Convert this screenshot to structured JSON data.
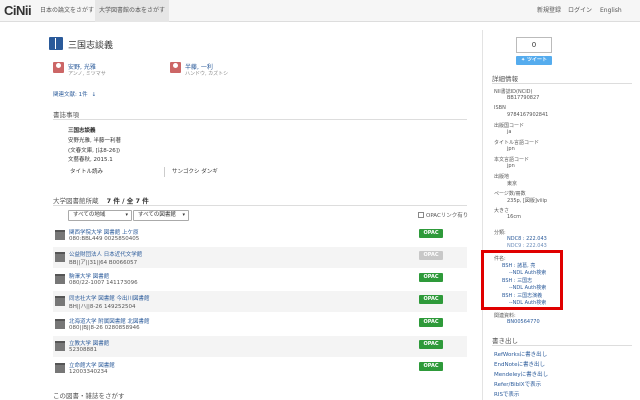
{
  "topbar": {
    "logo": "CiNii",
    "tabs": [
      "日本の論文をさがす",
      "大学図書館の本をさがす"
    ],
    "links": [
      "新規登録",
      "ログイン",
      "English"
    ]
  },
  "book": {
    "title": "三国志談義",
    "authors": [
      {
        "name": "安野, 光雅",
        "kana": "アンノ, ミツマサ"
      },
      {
        "name": "半藤, 一利",
        "kana": "ハンドウ, カズトシ"
      }
    ],
    "related": "関連文献: 1件"
  },
  "bibliography": {
    "heading": "書誌事項",
    "lines": [
      "三国志談義",
      "安野光雅, 半藤一利著",
      "(文春文庫, [は8-26])",
      "文藝春秋, 2015.1"
    ],
    "tags": [
      "タイトル読み",
      "サンゴクシ ダンギ"
    ]
  },
  "holdings": {
    "heading_prefix": "大学図書館所蔵",
    "count_text": "7 件 / 全 7 件",
    "filter_region": "すべての地域",
    "filter_library": "すべての図書館",
    "opac_toggle": "OPACリンク有り",
    "rows": [
      {
        "library": "関西学院大学 図書館 上ケ原",
        "call": "080:BBL449 0025850405",
        "opac": "OPAC",
        "opac_active": true
      },
      {
        "library": "公益財団法人 日本近代文学館",
        "call": "BB||ア||31||64 B0066057",
        "opac": "OPAC",
        "opac_active": false
      },
      {
        "library": "駒澤大学 図書館",
        "call": "080/22-1007 141173096",
        "opac": "OPAC",
        "opac_active": true
      },
      {
        "library": "同志社大学 図書館 今出川図書館",
        "call": "BH||ハ||8-26 149252504",
        "opac": "OPAC",
        "opac_active": true
      },
      {
        "library": "北海道大学 附属図書館 北図書館",
        "call": "080||BJ|8-26 0280858946",
        "opac": "OPAC",
        "opac_active": true
      },
      {
        "library": "立教大学 図書館",
        "call": "52308881",
        "opac": "OPAC",
        "opac_active": true
      },
      {
        "library": "立命館大学 図書館",
        "call": "12003340234",
        "opac": "OPAC",
        "opac_active": true
      }
    ]
  },
  "search_section": "この図書・雑誌をさがす",
  "sidebar": {
    "count": "0",
    "tweet": "ツイート",
    "details_heading": "詳細情報",
    "details": [
      {
        "label": "NII書誌ID(NCID)",
        "value": "BB17790827",
        "link": false
      },
      {
        "label": "ISBN",
        "value": "9784167902841",
        "link": false
      },
      {
        "label": "出版国コード",
        "value": "ja",
        "link": false
      },
      {
        "label": "タイトル言語コード",
        "value": "jpn",
        "link": false
      },
      {
        "label": "本文言語コード",
        "value": "jpn",
        "link": false
      },
      {
        "label": "出版地",
        "value": "東京",
        "link": false
      },
      {
        "label": "ページ数/冊数",
        "value": "235p, [図版]viiip",
        "link": false
      },
      {
        "label": "大きさ",
        "value": "16cm",
        "link": false
      }
    ],
    "classification_label": "分類:",
    "classification": [
      "NDC8 : 222.043",
      "NDC9 : 222.043"
    ],
    "subjects_label": "件名:",
    "subjects": [
      {
        "heading": "BSH : 諸葛, 亮",
        "sub": "--NDL Auth検索"
      },
      {
        "heading": "BSH : 三国志",
        "sub": "--NDL Auth検索"
      },
      {
        "heading": "BSH : 三国志演義",
        "sub": "--NDL Auth検索"
      }
    ],
    "ndl_label": "関連資料:",
    "ndl_value": "BN00564770",
    "export_heading": "書き出し",
    "exports": [
      "RefWorksに書き出し",
      "EndNoteに書き出し",
      "Mendeleyに書き出し",
      "Refer/BibIXで表示",
      "RISで表示"
    ]
  },
  "colors": {
    "link": "#2a5a9a",
    "opac_active": "#2e9a3a",
    "opac_inactive": "#c8c8c8",
    "highlight": "#e00000",
    "tweet": "#55acee"
  }
}
